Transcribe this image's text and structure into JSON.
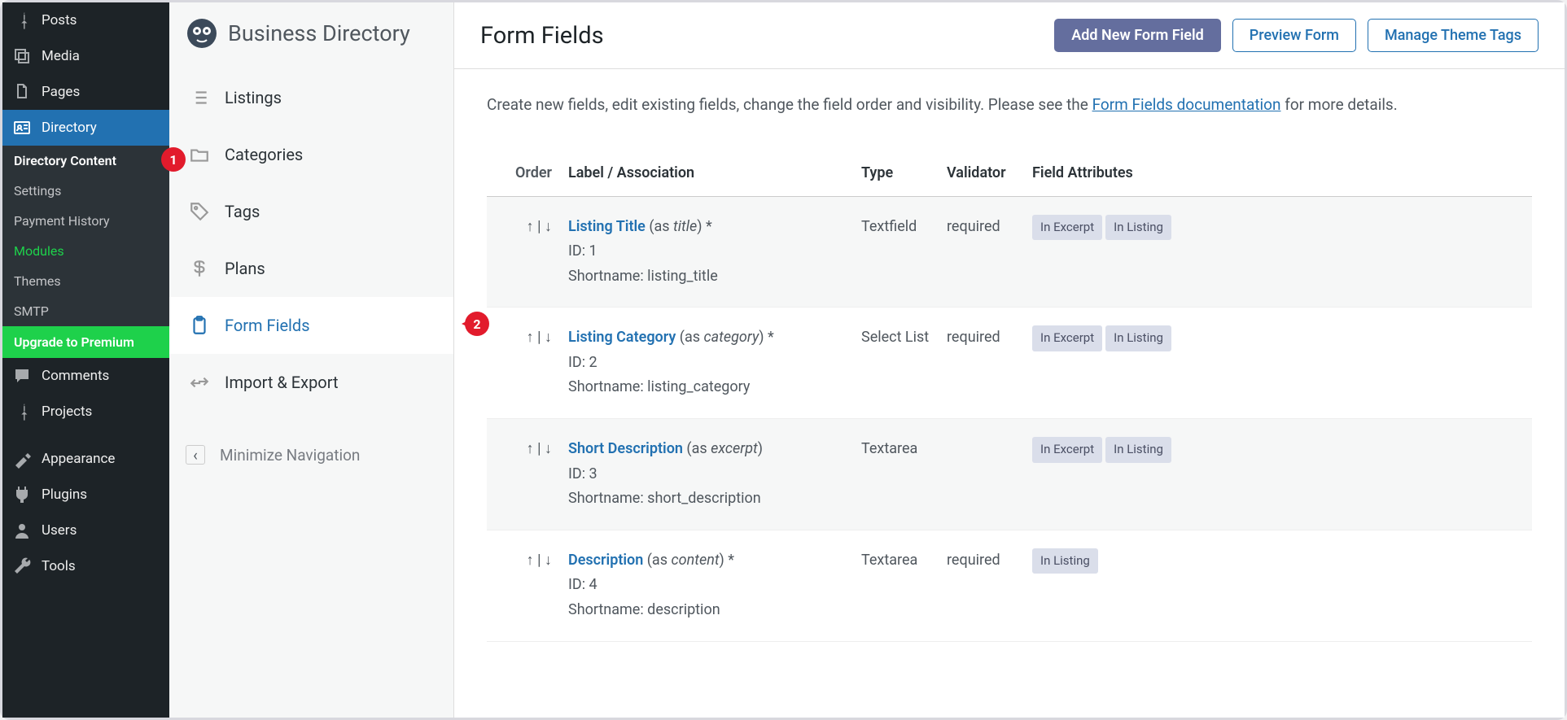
{
  "wp_menu": {
    "posts": "Posts",
    "media": "Media",
    "pages": "Pages",
    "directory": "Directory",
    "comments": "Comments",
    "projects": "Projects",
    "appearance": "Appearance",
    "plugins": "Plugins",
    "users": "Users",
    "tools": "Tools"
  },
  "wp_sub": {
    "content": "Directory Content",
    "settings": "Settings",
    "payment": "Payment History",
    "modules": "Modules",
    "themes": "Themes",
    "smtp": "SMTP",
    "upgrade": "Upgrade to Premium"
  },
  "bd": {
    "title": "Business Directory",
    "listings": "Listings",
    "categories": "Categories",
    "tags": "Tags",
    "plans": "Plans",
    "form_fields": "Form Fields",
    "import_export": "Import & Export",
    "minimize": "Minimize Navigation"
  },
  "page": {
    "title": "Form Fields",
    "add_btn": "Add New Form Field",
    "preview_btn": "Preview Form",
    "theme_tags_btn": "Manage Theme Tags",
    "intro_a": "Create new fields, edit existing fields, change the field order and visibility. Please see the ",
    "intro_link": "Form Fields documentation",
    "intro_b": " for more details."
  },
  "headers": {
    "order": "Order",
    "label": "Label / Association",
    "type": "Type",
    "validator": "Validator",
    "attributes": "Field Attributes"
  },
  "rows": [
    {
      "name": "Listing Title",
      "assoc": "title",
      "star": " *",
      "id": "ID: 1",
      "short": "Shortname: listing_title",
      "type": "Textfield",
      "val": "required",
      "excerpt": true,
      "listing": true
    },
    {
      "name": "Listing Category",
      "assoc": "category",
      "star": " *",
      "id": "ID: 2",
      "short": "Shortname: listing_category",
      "type": "Select List",
      "val": "required",
      "excerpt": true,
      "listing": true
    },
    {
      "name": "Short Description",
      "assoc": "excerpt",
      "star": "",
      "id": "ID: 3",
      "short": "Shortname: short_description",
      "type": "Textarea",
      "val": "",
      "excerpt": true,
      "listing": true
    },
    {
      "name": "Description",
      "assoc": "content",
      "star": " *",
      "id": "ID: 4",
      "short": "Shortname: description",
      "type": "Textarea",
      "val": "required",
      "excerpt": false,
      "listing": true
    }
  ],
  "badges": {
    "excerpt": "In Excerpt",
    "listing": "In Listing"
  },
  "markers": {
    "one": "1",
    "two": "2"
  },
  "order_controls": {
    "up": "↑",
    "sep": " | ",
    "down": "↓"
  }
}
